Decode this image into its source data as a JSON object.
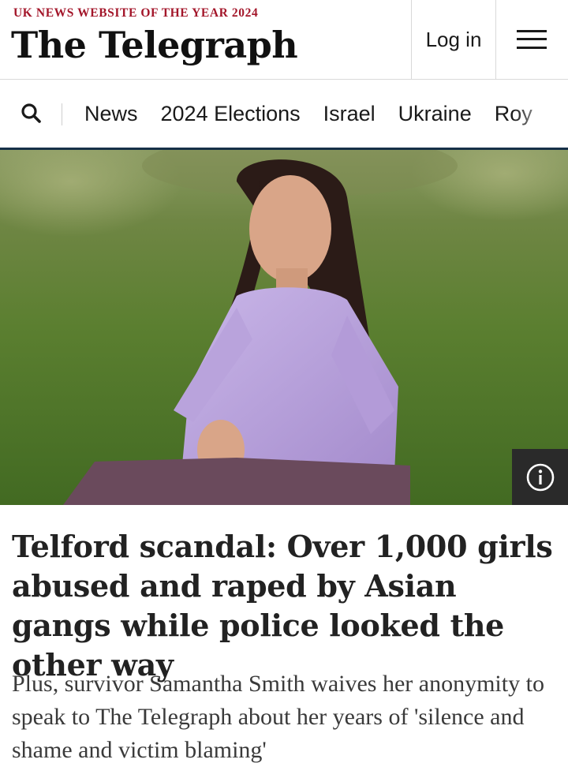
{
  "header": {
    "tagline": "UK NEWS WEBSITE OF THE YEAR 2024",
    "masthead": "The Telegraph",
    "login_label": "Log in"
  },
  "nav": {
    "items": [
      "News",
      "2024 Elections",
      "Israel",
      "Ukraine",
      "Roy"
    ]
  },
  "article": {
    "headline": "Telford scandal: Over 1,000 girls abused and raped by Asian gangs while police looked the other way",
    "standfirst": "Plus, survivor Samantha Smith waives her anonymity to speak to The Telegraph about her years of 'silence and shame and victim blaming'"
  },
  "colors": {
    "tagline": "#a3162a",
    "nav_underline": "#163048",
    "sweater": "#b9a3dc",
    "grass": "#4f7026"
  },
  "icons": [
    "search-icon",
    "menu-icon",
    "info-icon"
  ]
}
